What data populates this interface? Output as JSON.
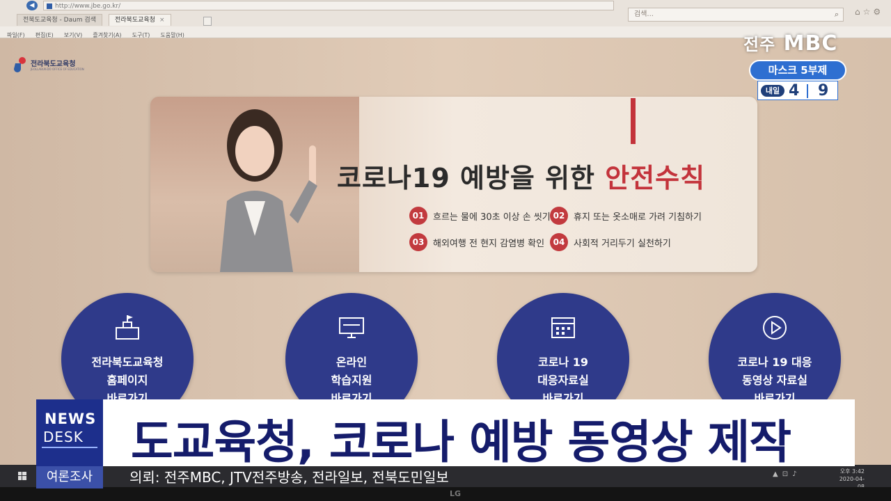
{
  "browser": {
    "url": "http://www.jbe.go.kr/",
    "tabs": [
      {
        "label": "전북도교육청 - Daum 검색",
        "active": false
      },
      {
        "label": "전라북도교육청",
        "active": true
      }
    ],
    "search_placeholder": "검색...",
    "menu": [
      "파일(F)",
      "편집(E)",
      "보기(V)",
      "즐겨찾기(A)",
      "도구(T)",
      "도움말(H)"
    ]
  },
  "site": {
    "logo_text": "전라북도교육청",
    "logo_sub": "JEOLLABUK-DO OFFICE OF EDUCATION"
  },
  "banner": {
    "title_main": "코로나19 예방을 위한 ",
    "title_highlight": "안전수칙",
    "rules": [
      {
        "num": "01",
        "text": "흐르는 물에 30초 이상 손 씻기"
      },
      {
        "num": "02",
        "text": "휴지 또는 옷소매로 가려 기침하기"
      },
      {
        "num": "03",
        "text": "해외여행 전 현지 감염병 확인"
      },
      {
        "num": "04",
        "text": "사회적 거리두기 실천하기"
      }
    ]
  },
  "quick_links": [
    {
      "lines": [
        "전라북도교육청",
        "홈페이지",
        "바로가기"
      ],
      "icon": "building-flag-icon"
    },
    {
      "lines": [
        "온라인",
        "학습지원",
        "바로가기"
      ],
      "icon": "monitor-icon"
    },
    {
      "lines": [
        "코로나 19",
        "대응자료실",
        "바로가기"
      ],
      "icon": "calendar-icon"
    },
    {
      "lines": [
        "코로나 19 대응",
        "동영상 자료실",
        "바로가기"
      ],
      "icon": "play-circle-icon"
    }
  ],
  "taskbar": {
    "time": "오후 3:42",
    "date": "2020-04-08"
  },
  "bezel": {
    "brand": "LG"
  },
  "broadcast": {
    "station_city": "전주",
    "station_name": "MBC",
    "mask_title": "마스크 5부제",
    "mask_tomorrow": "내일",
    "mask_num1": "4",
    "mask_num2": "9",
    "logo_top": "NEWS",
    "logo_bottom": "DESK",
    "headline": "도교육청, 코로나 예방 동영상 제작",
    "poll_tag": "여론조사",
    "source": "의뢰: 전주MBC, JTV전주방송, 전라일보, 전북도민일보"
  },
  "colors": {
    "brand_navy": "#2f3a8a",
    "accent_red": "#c3333b",
    "headline_navy": "#151c6b",
    "mask_blue": "#2e6fd1"
  }
}
